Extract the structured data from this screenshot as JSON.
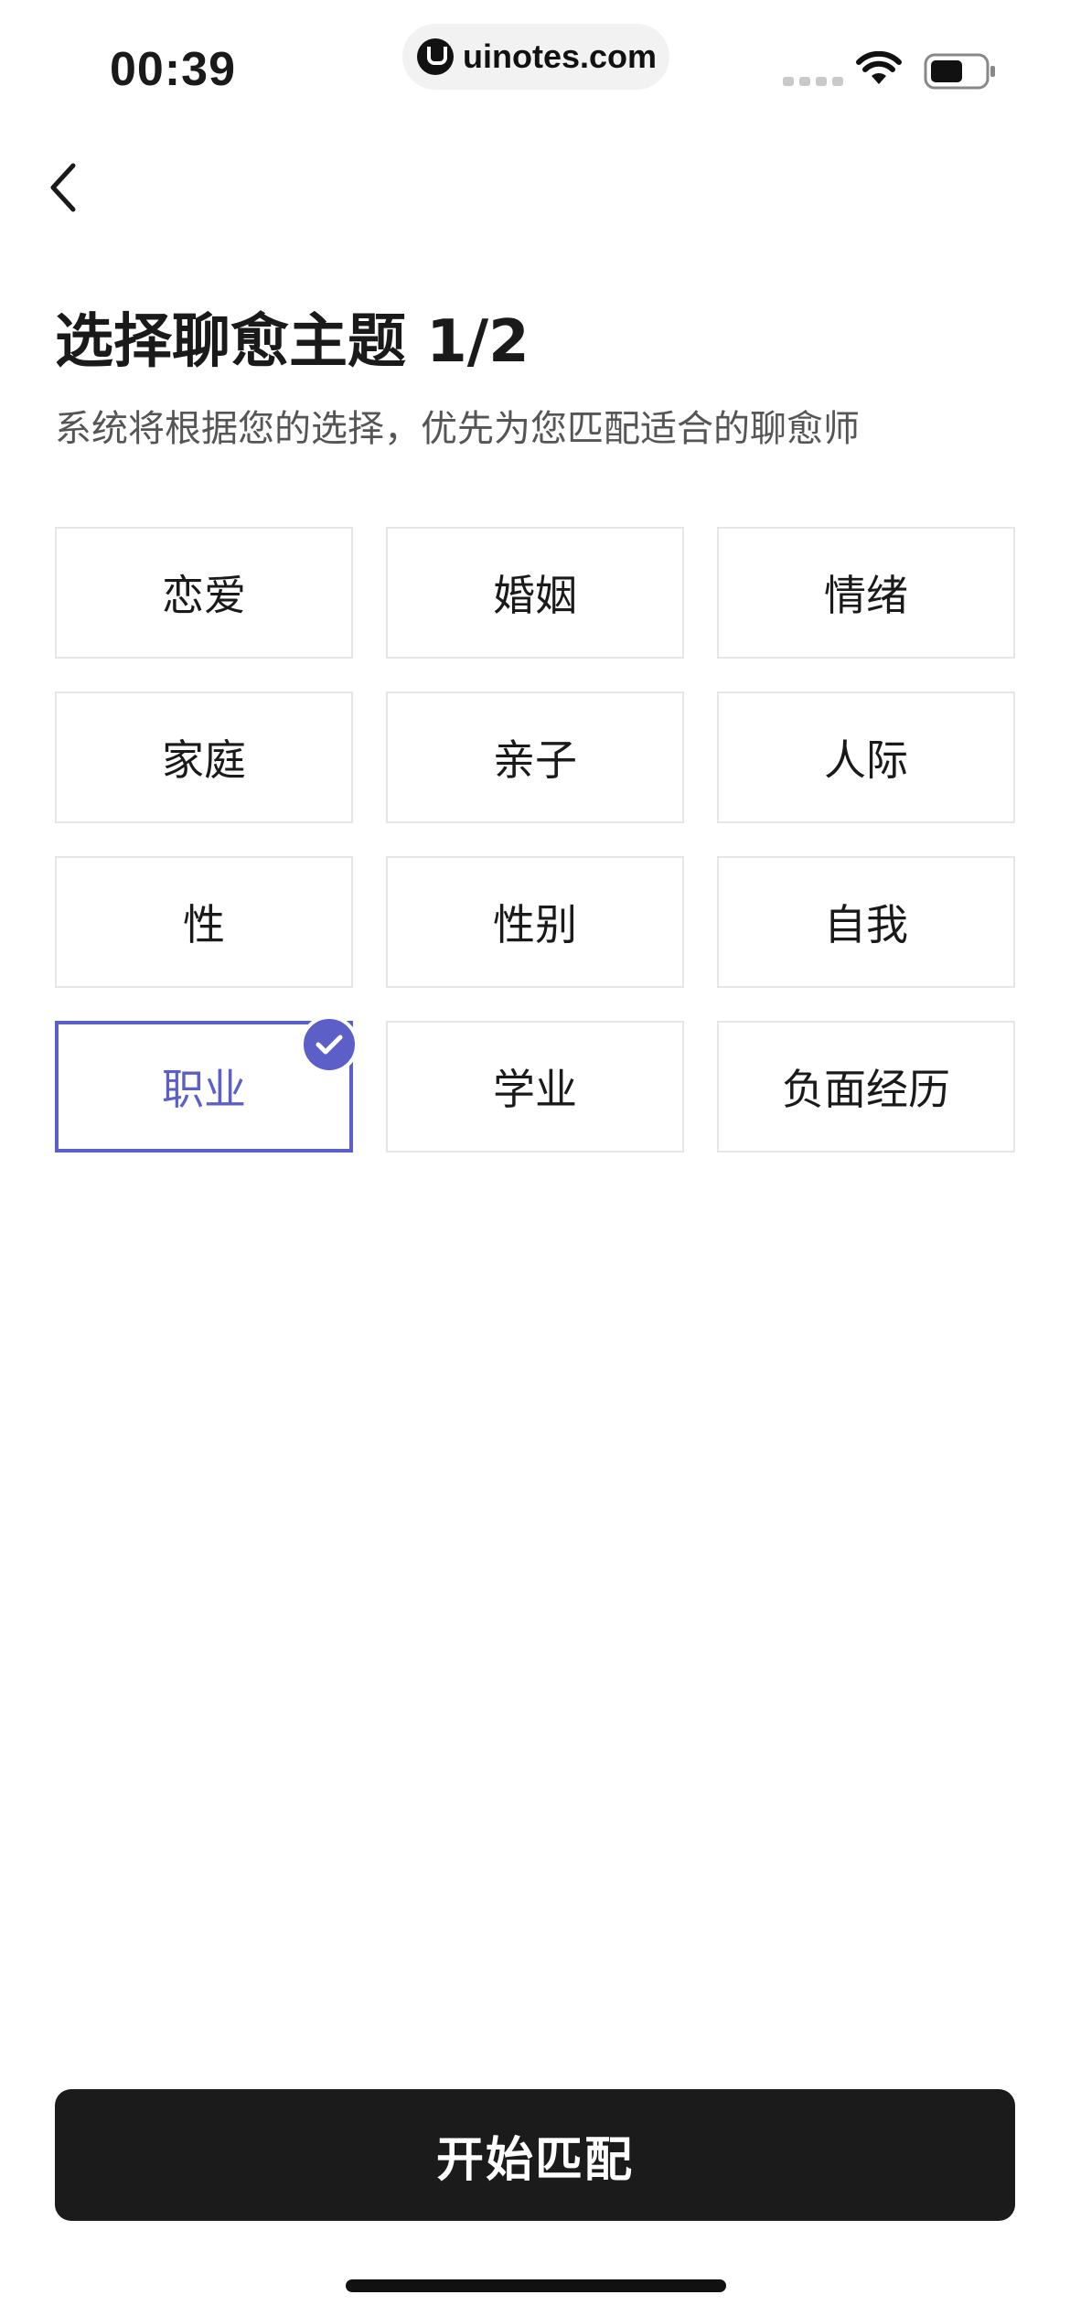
{
  "status_bar": {
    "time": "00:39",
    "url": "uinotes.com",
    "icons": [
      "signal-dots-icon",
      "wifi-icon",
      "battery-icon"
    ]
  },
  "nav": {
    "back_icon": "chevron-left-icon"
  },
  "header": {
    "title": "选择聊愈主题 1/2",
    "subtitle": "系统将根据您的选择，优先为您匹配适合的聊愈师"
  },
  "topics": {
    "items": [
      {
        "label": "恋爱",
        "selected": false
      },
      {
        "label": "婚姻",
        "selected": false
      },
      {
        "label": "情绪",
        "selected": false
      },
      {
        "label": "家庭",
        "selected": false
      },
      {
        "label": "亲子",
        "selected": false
      },
      {
        "label": "人际",
        "selected": false
      },
      {
        "label": "性",
        "selected": false
      },
      {
        "label": "性别",
        "selected": false
      },
      {
        "label": "自我",
        "selected": false
      },
      {
        "label": "职业",
        "selected": true
      },
      {
        "label": "学业",
        "selected": false
      },
      {
        "label": "负面经历",
        "selected": false
      }
    ]
  },
  "footer": {
    "start_label": "开始匹配"
  },
  "colors": {
    "accent": "#5b5fc7",
    "button_bg": "#1b1b1b",
    "chip_border": "#e6e6e6",
    "subtitle": "#555555"
  }
}
